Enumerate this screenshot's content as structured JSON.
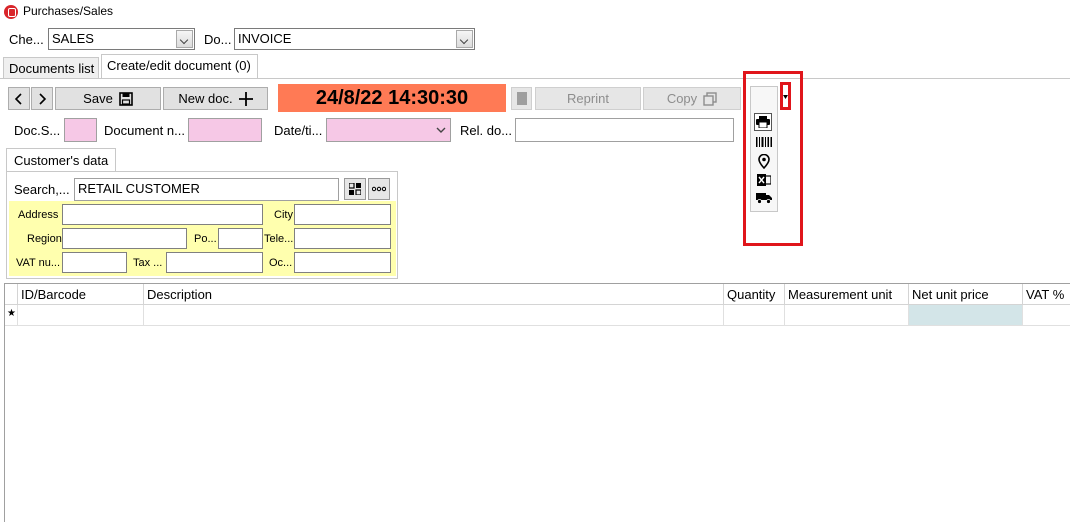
{
  "window": {
    "title": "Purchases/Sales"
  },
  "header": {
    "check_label": "Che...",
    "check_value": "SALES",
    "doc_label": "Do...",
    "doc_value": "INVOICE"
  },
  "tabs": [
    {
      "label": "Documents list"
    },
    {
      "label": "Create/edit document (0)"
    }
  ],
  "toolbar": {
    "save_label": "Save",
    "new_doc_label": "New doc.",
    "datetime": "24/8/22 14:30:30",
    "reprint_label": "Reprint",
    "copy_label": "Copy"
  },
  "doc_fields": {
    "doc_series_label": "Doc.S...",
    "doc_number_label": "Document n...",
    "datetime_label": "Date/ti...",
    "related_doc_label": "Rel. do..."
  },
  "customer": {
    "tab_label": "Customer's data",
    "search_label": "Search,...",
    "search_value": "RETAIL CUSTOMER",
    "address_label": "Address",
    "city_label": "City",
    "region_label": "Region",
    "postal_label": "Po...",
    "phone_label": "Tele...",
    "vat_label": "VAT nu...",
    "tax_label": "Tax ...",
    "occupation_label": "Oc..."
  },
  "grid": {
    "columns": [
      "ID/Barcode",
      "Description",
      "Quantity",
      "Measurement unit",
      "Net unit price",
      "VAT %"
    ],
    "new_row_marker": "★"
  },
  "print_menu": {
    "items": [
      "printer-icon",
      "barcode-icon",
      "location-pin-icon",
      "excel-icon",
      "truck-icon"
    ]
  },
  "colors": {
    "datetime_bg": "#ff7a55",
    "required_field": "#f6c8e6",
    "customer_panel": "#ffffae",
    "highlight": "#e0151b",
    "price_cell": "#d3e5e8"
  }
}
